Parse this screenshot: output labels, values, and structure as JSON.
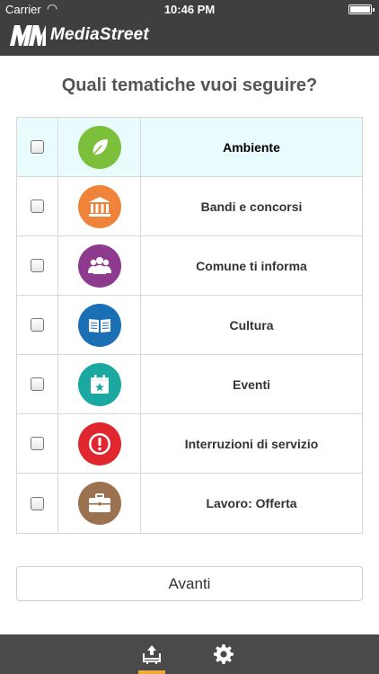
{
  "status_bar": {
    "carrier": "Carrier",
    "time": "10:46 PM"
  },
  "header": {
    "brand": "MediaStreet"
  },
  "main": {
    "title": "Quali tematiche vuoi seguire?",
    "topics": [
      {
        "label": "Ambiente",
        "icon": "leaf-icon",
        "color": "#7cbf3a",
        "selected": true
      },
      {
        "label": "Bandi e concorsi",
        "icon": "institution-icon",
        "color": "#f0833a",
        "selected": false
      },
      {
        "label": "Comune ti informa",
        "icon": "people-icon",
        "color": "#8e3a8e",
        "selected": false
      },
      {
        "label": "Cultura",
        "icon": "book-icon",
        "color": "#1a6fb5",
        "selected": false
      },
      {
        "label": "Eventi",
        "icon": "calendar-icon",
        "color": "#1aa8a0",
        "selected": false
      },
      {
        "label": "Interruzioni di servizio",
        "icon": "alert-icon",
        "color": "#e0262e",
        "selected": false
      },
      {
        "label": "Lavoro: Offerta",
        "icon": "briefcase-icon",
        "color": "#9b7250",
        "selected": false
      }
    ],
    "next_label": "Avanti"
  },
  "tabbar": {
    "active_color": "#f2a93b"
  }
}
